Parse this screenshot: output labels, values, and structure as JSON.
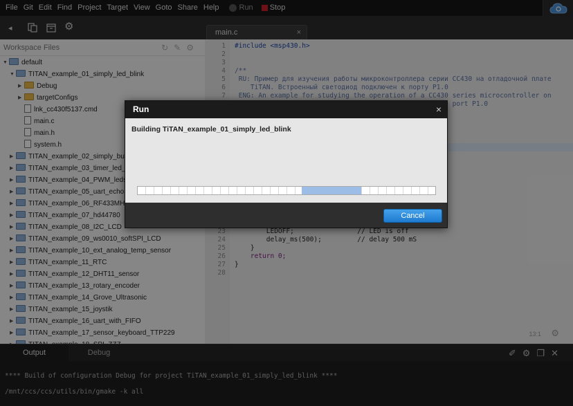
{
  "menu": {
    "items": [
      "File",
      "Git",
      "Edit",
      "Find",
      "Project",
      "Target",
      "View",
      "Goto",
      "Share",
      "Help"
    ],
    "run_label": "Run",
    "stop_label": "Stop"
  },
  "editor_tab": {
    "filename": "main.c",
    "close_glyph": "×"
  },
  "sidebar": {
    "title": "Workspace Files",
    "tree": [
      {
        "label": "default",
        "type": "folder-blue",
        "expanded": true,
        "level": 0
      },
      {
        "label": "TITAN_example_01_simply_led_blink",
        "type": "folder-blue",
        "expanded": true,
        "level": 1
      },
      {
        "label": "Debug",
        "type": "folder",
        "expanded": false,
        "level": 2
      },
      {
        "label": "targetConfigs",
        "type": "folder",
        "expanded": false,
        "level": 2
      },
      {
        "label": "lnk_cc430f5137.cmd",
        "type": "file",
        "level": 2
      },
      {
        "label": "main.c",
        "type": "file",
        "level": 2
      },
      {
        "label": "main.h",
        "type": "file",
        "level": 2
      },
      {
        "label": "system.h",
        "type": "file",
        "level": 2
      },
      {
        "label": "TITAN_example_02_simply_button",
        "type": "folder-blue",
        "expanded": false,
        "level": 1
      },
      {
        "label": "TITAN_example_03_timer_led_blink",
        "type": "folder-blue",
        "expanded": false,
        "level": 1
      },
      {
        "label": "TITAN_example_04_PWM_leds",
        "type": "folder-blue",
        "expanded": false,
        "level": 1
      },
      {
        "label": "TITAN_example_05_uart_echo",
        "type": "folder-blue",
        "expanded": false,
        "level": 1
      },
      {
        "label": "TITAN_example_06_RF433MHZ_test",
        "type": "folder-blue",
        "expanded": false,
        "level": 1
      },
      {
        "label": "TITAN_example_07_hd44780",
        "type": "folder-blue",
        "expanded": false,
        "level": 1
      },
      {
        "label": "TITAN_example_08_I2C_LCD",
        "type": "folder-blue",
        "expanded": false,
        "level": 1
      },
      {
        "label": "TITAN_example_09_ws0010_softSPI_LCD",
        "type": "folder-blue",
        "expanded": false,
        "level": 1
      },
      {
        "label": "TITAN_example_10_ext_analog_temp_sensor",
        "type": "folder-blue",
        "expanded": false,
        "level": 1
      },
      {
        "label": "TITAN_example_11_RTC",
        "type": "folder-blue",
        "expanded": false,
        "level": 1
      },
      {
        "label": "TITAN_example_12_DHT11_sensor",
        "type": "folder-blue",
        "expanded": false,
        "level": 1
      },
      {
        "label": "TITAN_example_13_rotary_encoder",
        "type": "folder-blue",
        "expanded": false,
        "level": 1
      },
      {
        "label": "TITAN_example_14_Grove_Ultrasonic",
        "type": "folder-blue",
        "expanded": false,
        "level": 1
      },
      {
        "label": "TITAN_example_15_joystik",
        "type": "folder-blue",
        "expanded": false,
        "level": 1
      },
      {
        "label": "TITAN_example_16_uart_with_FIFO",
        "type": "folder-blue",
        "expanded": false,
        "level": 1
      },
      {
        "label": "TITAN_example_17_sensor_keyboard_TTP229",
        "type": "folder-blue",
        "expanded": false,
        "level": 1
      },
      {
        "label": "TITAN_example_18_SPI_ZZZ",
        "type": "folder-blue",
        "expanded": false,
        "level": 1
      }
    ]
  },
  "code": {
    "lines": [
      {
        "n": "1",
        "text": "#include <msp430.h>"
      },
      {
        "n": "2",
        "text": ""
      },
      {
        "n": "3",
        "text": ""
      },
      {
        "n": "4",
        "text": "/**"
      },
      {
        "n": "5",
        "text": " RU: Пример для изучения работы микроконтроллера серии CC430 на отладочной плате"
      },
      {
        "n": "6",
        "text": "    TiTAN. Встроенный светодиод подключен к порту P1.0"
      },
      {
        "n": "7",
        "text": " ENG: An example for studying the operation of a CC430 series microcontroller on"
      },
      {
        "n": "8",
        "text": "                                                   the port P1.0"
      },
      {
        "n": "23",
        "text": "        LEDOFF;                // LED is off"
      },
      {
        "n": "24",
        "text": "        delay_ms(500);         // delay 500 mS"
      },
      {
        "n": "25",
        "text": "    }"
      },
      {
        "n": "26",
        "text": "    return 0;"
      },
      {
        "n": "27",
        "text": "}"
      },
      {
        "n": "28",
        "text": ""
      }
    ],
    "cursor_pos": "13:1"
  },
  "bottom_panel": {
    "tabs": [
      "Output",
      "Debug"
    ],
    "console": [
      "**** Build of configuration Debug for project TiTAN_example_01_simply_led_blink ****",
      "/mnt/ccs/ccs/utils/bin/gmake -k all"
    ]
  },
  "dialog": {
    "title": "Run",
    "close_glyph": "×",
    "message": "Building TiTAN_example_01_simply_led_blink",
    "progress_start_fraction": 0.55,
    "progress_end_fraction": 0.75,
    "cancel_label": "Cancel"
  },
  "colors": {
    "accent_button": "#2a87d8",
    "progress_fill": "#9bbde6",
    "stop_red": "#c8202a"
  },
  "icons": [
    "back-icon",
    "copy-icon",
    "box-icon",
    "gear-icon",
    "refresh-icon",
    "wand-icon",
    "broom-icon",
    "cloud-icon"
  ]
}
